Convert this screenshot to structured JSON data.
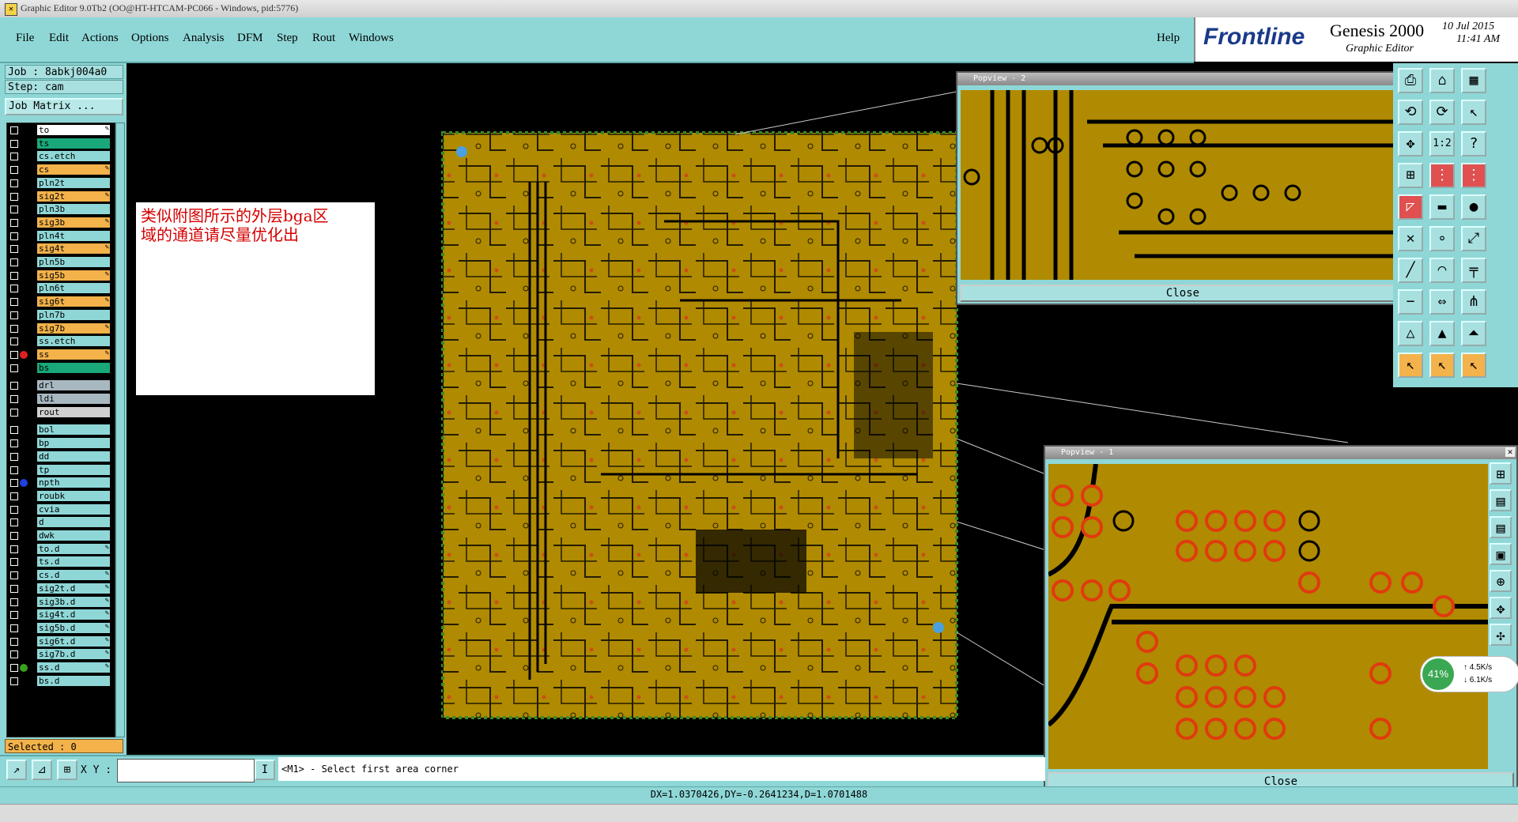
{
  "window": {
    "title": "Graphic Editor 9.0Tb2 (OO@HT-HTCAM-PC066 - Windows, pid:5776)"
  },
  "menu": {
    "items": [
      "File",
      "Edit",
      "Actions",
      "Options",
      "Analysis",
      "DFM",
      "Step",
      "Rout",
      "Windows"
    ],
    "help": "Help"
  },
  "brand": {
    "logo": "Frontline",
    "product": "Genesis 2000",
    "subtitle": "Graphic Editor",
    "date": "10 Jul 2015",
    "time": "11:41 AM"
  },
  "job": {
    "job_label": "Job : 8abkj004a0",
    "step_label": "Step: cam",
    "matrix_button": "Job Matrix ..."
  },
  "layers": [
    {
      "name": "to",
      "color": "#ffffff",
      "edit": true
    },
    {
      "name": "ts",
      "color": "#1aa87a",
      "edit": false
    },
    {
      "name": "cs.etch",
      "color": "#8fd7d7",
      "edit": false
    },
    {
      "name": "cs",
      "color": "#f3b24a",
      "edit": true
    },
    {
      "name": "pln2t",
      "color": "#8fd7d7",
      "edit": false
    },
    {
      "name": "sig2t",
      "color": "#f3b24a",
      "edit": true
    },
    {
      "name": "pln3b",
      "color": "#8fd7d7",
      "edit": false
    },
    {
      "name": "sig3b",
      "color": "#f3b24a",
      "edit": true
    },
    {
      "name": "pln4t",
      "color": "#8fd7d7",
      "edit": false
    },
    {
      "name": "sig4t",
      "color": "#f3b24a",
      "edit": true
    },
    {
      "name": "pln5b",
      "color": "#8fd7d7",
      "edit": false
    },
    {
      "name": "sig5b",
      "color": "#f3b24a",
      "edit": true
    },
    {
      "name": "pln6t",
      "color": "#8fd7d7",
      "edit": false
    },
    {
      "name": "sig6t",
      "color": "#f3b24a",
      "edit": true
    },
    {
      "name": "pln7b",
      "color": "#8fd7d7",
      "edit": false
    },
    {
      "name": "sig7b",
      "color": "#f3b24a",
      "edit": true
    },
    {
      "name": "ss.etch",
      "color": "#8fd7d7",
      "edit": false
    },
    {
      "name": "ss",
      "color": "#f3b24a",
      "edit": true,
      "dot": "#e02020"
    },
    {
      "name": "bs",
      "color": "#1aa87a",
      "edit": false
    },
    {
      "name": "drl",
      "color": "#a8b8c0",
      "edit": false
    },
    {
      "name": "ldi",
      "color": "#a8b8c0",
      "edit": false
    },
    {
      "name": "rout",
      "color": "#d0d0d0",
      "edit": false
    },
    {
      "name": "bol",
      "color": "#8fd7d7",
      "edit": false
    },
    {
      "name": "bp",
      "color": "#8fd7d7",
      "edit": false
    },
    {
      "name": "dd",
      "color": "#8fd7d7",
      "edit": false
    },
    {
      "name": "tp",
      "color": "#8fd7d7",
      "edit": false
    },
    {
      "name": "npth",
      "color": "#8fd7d7",
      "edit": false,
      "dot": "#2040e0"
    },
    {
      "name": "roubk",
      "color": "#8fd7d7",
      "edit": false
    },
    {
      "name": "cvia",
      "color": "#8fd7d7",
      "edit": false
    },
    {
      "name": "d",
      "color": "#8fd7d7",
      "edit": false
    },
    {
      "name": "dwk",
      "color": "#8fd7d7",
      "edit": false
    },
    {
      "name": "to.d",
      "color": "#8fd7d7",
      "edit": true
    },
    {
      "name": "ts.d",
      "color": "#8fd7d7",
      "edit": false
    },
    {
      "name": "cs.d",
      "color": "#8fd7d7",
      "edit": true
    },
    {
      "name": "sig2t.d",
      "color": "#8fd7d7",
      "edit": true
    },
    {
      "name": "sig3b.d",
      "color": "#8fd7d7",
      "edit": true
    },
    {
      "name": "sig4t.d",
      "color": "#8fd7d7",
      "edit": true
    },
    {
      "name": "sig5b.d",
      "color": "#8fd7d7",
      "edit": true
    },
    {
      "name": "sig6t.d",
      "color": "#8fd7d7",
      "edit": true
    },
    {
      "name": "sig7b.d",
      "color": "#8fd7d7",
      "edit": true
    },
    {
      "name": "ss.d",
      "color": "#8fd7d7",
      "edit": true,
      "dot": "#3aa020"
    },
    {
      "name": "bs.d",
      "color": "#8fd7d7",
      "edit": false
    }
  ],
  "selected": "Selected : 0",
  "note": {
    "line1": "类似附图所示的外层bga区",
    "line2": "域的通道请尽量优化出"
  },
  "popview2": {
    "title": "Popview - 2",
    "close": "Close"
  },
  "popview1": {
    "title": "Popview - 1",
    "close": "Close"
  },
  "bottom": {
    "xy_label": "X Y :",
    "xy_value": "",
    "prompt": "<M1> - Select first area corner"
  },
  "status": "DX=1.0370426,DY=-0.2641234,D=1.0701488",
  "net": {
    "percent": "41%",
    "up": "4.5K/s",
    "down": "6.1K/s"
  },
  "colors": {
    "board": "#b08a00",
    "panel": "#8fd7d7",
    "accent": "#f3b24a"
  }
}
